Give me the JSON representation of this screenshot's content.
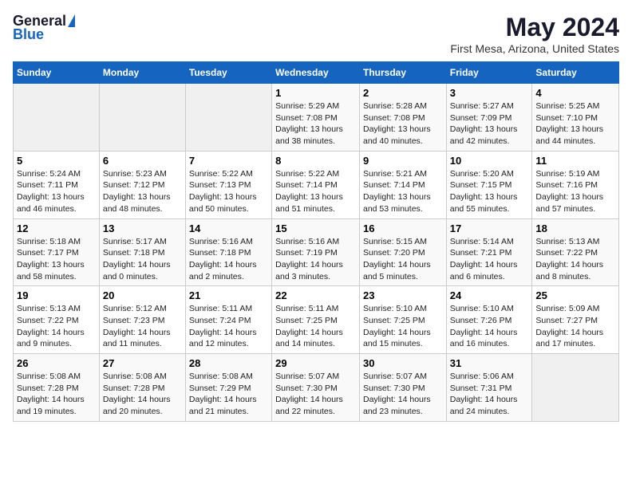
{
  "header": {
    "logo_general": "General",
    "logo_blue": "Blue",
    "title": "May 2024",
    "location": "First Mesa, Arizona, United States"
  },
  "weekdays": [
    "Sunday",
    "Monday",
    "Tuesday",
    "Wednesday",
    "Thursday",
    "Friday",
    "Saturday"
  ],
  "weeks": [
    [
      {
        "day": "",
        "sunrise": "",
        "sunset": "",
        "daylight": ""
      },
      {
        "day": "",
        "sunrise": "",
        "sunset": "",
        "daylight": ""
      },
      {
        "day": "",
        "sunrise": "",
        "sunset": "",
        "daylight": ""
      },
      {
        "day": "1",
        "sunrise": "Sunrise: 5:29 AM",
        "sunset": "Sunset: 7:08 PM",
        "daylight": "Daylight: 13 hours and 38 minutes."
      },
      {
        "day": "2",
        "sunrise": "Sunrise: 5:28 AM",
        "sunset": "Sunset: 7:08 PM",
        "daylight": "Daylight: 13 hours and 40 minutes."
      },
      {
        "day": "3",
        "sunrise": "Sunrise: 5:27 AM",
        "sunset": "Sunset: 7:09 PM",
        "daylight": "Daylight: 13 hours and 42 minutes."
      },
      {
        "day": "4",
        "sunrise": "Sunrise: 5:25 AM",
        "sunset": "Sunset: 7:10 PM",
        "daylight": "Daylight: 13 hours and 44 minutes."
      }
    ],
    [
      {
        "day": "5",
        "sunrise": "Sunrise: 5:24 AM",
        "sunset": "Sunset: 7:11 PM",
        "daylight": "Daylight: 13 hours and 46 minutes."
      },
      {
        "day": "6",
        "sunrise": "Sunrise: 5:23 AM",
        "sunset": "Sunset: 7:12 PM",
        "daylight": "Daylight: 13 hours and 48 minutes."
      },
      {
        "day": "7",
        "sunrise": "Sunrise: 5:22 AM",
        "sunset": "Sunset: 7:13 PM",
        "daylight": "Daylight: 13 hours and 50 minutes."
      },
      {
        "day": "8",
        "sunrise": "Sunrise: 5:22 AM",
        "sunset": "Sunset: 7:14 PM",
        "daylight": "Daylight: 13 hours and 51 minutes."
      },
      {
        "day": "9",
        "sunrise": "Sunrise: 5:21 AM",
        "sunset": "Sunset: 7:14 PM",
        "daylight": "Daylight: 13 hours and 53 minutes."
      },
      {
        "day": "10",
        "sunrise": "Sunrise: 5:20 AM",
        "sunset": "Sunset: 7:15 PM",
        "daylight": "Daylight: 13 hours and 55 minutes."
      },
      {
        "day": "11",
        "sunrise": "Sunrise: 5:19 AM",
        "sunset": "Sunset: 7:16 PM",
        "daylight": "Daylight: 13 hours and 57 minutes."
      }
    ],
    [
      {
        "day": "12",
        "sunrise": "Sunrise: 5:18 AM",
        "sunset": "Sunset: 7:17 PM",
        "daylight": "Daylight: 13 hours and 58 minutes."
      },
      {
        "day": "13",
        "sunrise": "Sunrise: 5:17 AM",
        "sunset": "Sunset: 7:18 PM",
        "daylight": "Daylight: 14 hours and 0 minutes."
      },
      {
        "day": "14",
        "sunrise": "Sunrise: 5:16 AM",
        "sunset": "Sunset: 7:18 PM",
        "daylight": "Daylight: 14 hours and 2 minutes."
      },
      {
        "day": "15",
        "sunrise": "Sunrise: 5:16 AM",
        "sunset": "Sunset: 7:19 PM",
        "daylight": "Daylight: 14 hours and 3 minutes."
      },
      {
        "day": "16",
        "sunrise": "Sunrise: 5:15 AM",
        "sunset": "Sunset: 7:20 PM",
        "daylight": "Daylight: 14 hours and 5 minutes."
      },
      {
        "day": "17",
        "sunrise": "Sunrise: 5:14 AM",
        "sunset": "Sunset: 7:21 PM",
        "daylight": "Daylight: 14 hours and 6 minutes."
      },
      {
        "day": "18",
        "sunrise": "Sunrise: 5:13 AM",
        "sunset": "Sunset: 7:22 PM",
        "daylight": "Daylight: 14 hours and 8 minutes."
      }
    ],
    [
      {
        "day": "19",
        "sunrise": "Sunrise: 5:13 AM",
        "sunset": "Sunset: 7:22 PM",
        "daylight": "Daylight: 14 hours and 9 minutes."
      },
      {
        "day": "20",
        "sunrise": "Sunrise: 5:12 AM",
        "sunset": "Sunset: 7:23 PM",
        "daylight": "Daylight: 14 hours and 11 minutes."
      },
      {
        "day": "21",
        "sunrise": "Sunrise: 5:11 AM",
        "sunset": "Sunset: 7:24 PM",
        "daylight": "Daylight: 14 hours and 12 minutes."
      },
      {
        "day": "22",
        "sunrise": "Sunrise: 5:11 AM",
        "sunset": "Sunset: 7:25 PM",
        "daylight": "Daylight: 14 hours and 14 minutes."
      },
      {
        "day": "23",
        "sunrise": "Sunrise: 5:10 AM",
        "sunset": "Sunset: 7:25 PM",
        "daylight": "Daylight: 14 hours and 15 minutes."
      },
      {
        "day": "24",
        "sunrise": "Sunrise: 5:10 AM",
        "sunset": "Sunset: 7:26 PM",
        "daylight": "Daylight: 14 hours and 16 minutes."
      },
      {
        "day": "25",
        "sunrise": "Sunrise: 5:09 AM",
        "sunset": "Sunset: 7:27 PM",
        "daylight": "Daylight: 14 hours and 17 minutes."
      }
    ],
    [
      {
        "day": "26",
        "sunrise": "Sunrise: 5:08 AM",
        "sunset": "Sunset: 7:28 PM",
        "daylight": "Daylight: 14 hours and 19 minutes."
      },
      {
        "day": "27",
        "sunrise": "Sunrise: 5:08 AM",
        "sunset": "Sunset: 7:28 PM",
        "daylight": "Daylight: 14 hours and 20 minutes."
      },
      {
        "day": "28",
        "sunrise": "Sunrise: 5:08 AM",
        "sunset": "Sunset: 7:29 PM",
        "daylight": "Daylight: 14 hours and 21 minutes."
      },
      {
        "day": "29",
        "sunrise": "Sunrise: 5:07 AM",
        "sunset": "Sunset: 7:30 PM",
        "daylight": "Daylight: 14 hours and 22 minutes."
      },
      {
        "day": "30",
        "sunrise": "Sunrise: 5:07 AM",
        "sunset": "Sunset: 7:30 PM",
        "daylight": "Daylight: 14 hours and 23 minutes."
      },
      {
        "day": "31",
        "sunrise": "Sunrise: 5:06 AM",
        "sunset": "Sunset: 7:31 PM",
        "daylight": "Daylight: 14 hours and 24 minutes."
      },
      {
        "day": "",
        "sunrise": "",
        "sunset": "",
        "daylight": ""
      }
    ]
  ]
}
